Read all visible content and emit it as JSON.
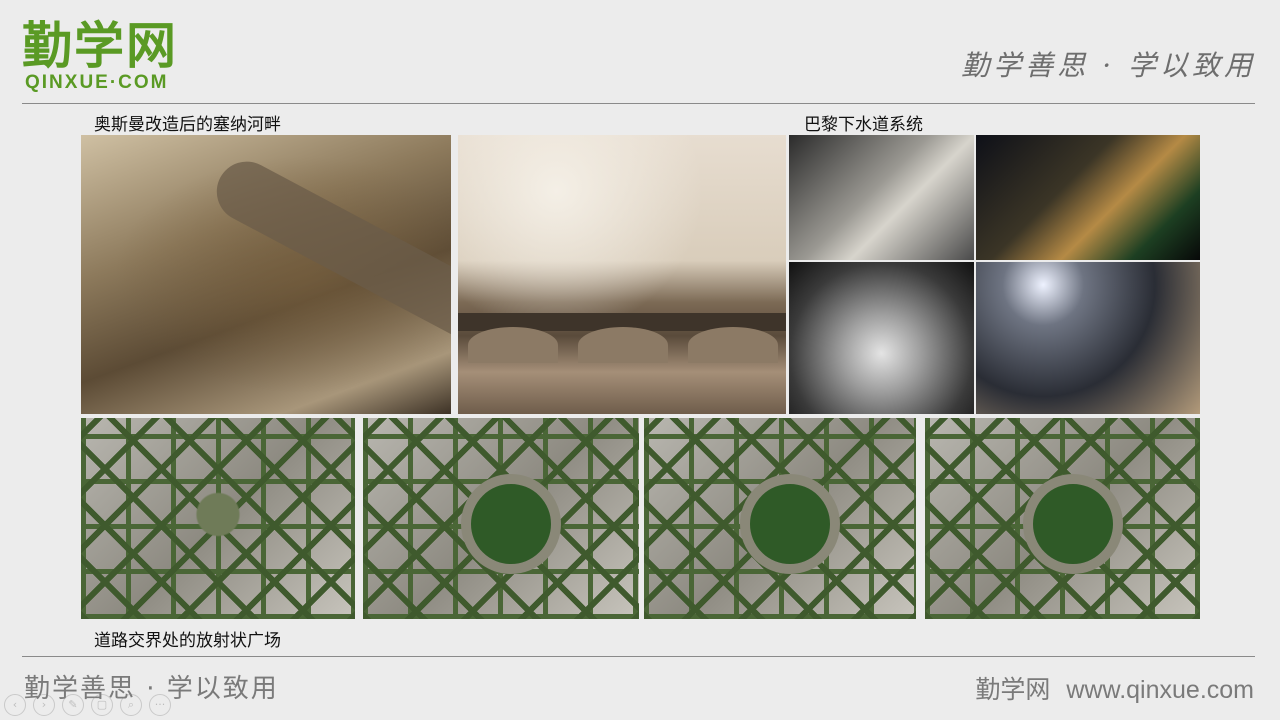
{
  "header": {
    "logo_cn": "勤学网",
    "logo_en": "QINXUE·COM",
    "slogan": "勤学善思 · 学以致用"
  },
  "captions": {
    "seine": "奥斯曼改造后的塞纳河畔",
    "sewer": "巴黎下水道系统",
    "roads": "道路交界处的放射状广场"
  },
  "footer": {
    "slogan": "勤学善思 · 学以致用",
    "site_name": "勤学网",
    "url": "www.qinxue.com"
  },
  "toolbar": {
    "icons": [
      "prev-icon",
      "next-icon",
      "pen-icon",
      "slides-icon",
      "zoom-icon",
      "more-icon"
    ],
    "glyphs": [
      "‹",
      "›",
      "✎",
      "▢",
      "⌕",
      "···"
    ]
  }
}
